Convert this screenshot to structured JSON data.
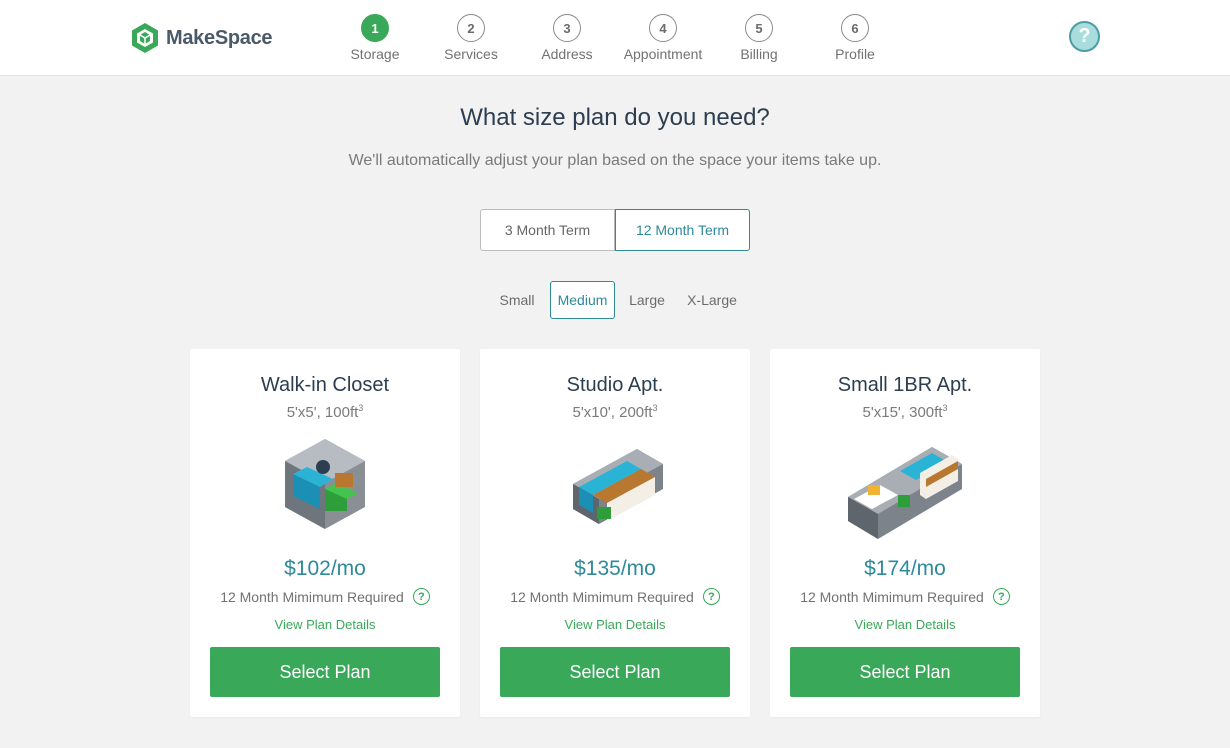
{
  "brand": {
    "name": "MakeSpace",
    "color": "#3aa859"
  },
  "steps": [
    {
      "num": "1",
      "label": "Storage"
    },
    {
      "num": "2",
      "label": "Services"
    },
    {
      "num": "3",
      "label": "Address"
    },
    {
      "num": "4",
      "label": "Appointment"
    },
    {
      "num": "5",
      "label": "Billing"
    },
    {
      "num": "6",
      "label": "Profile"
    }
  ],
  "active_step": "1",
  "help_icon": "question-icon",
  "heading": {
    "title": "What size plan do you need?",
    "subtitle": "We'll automatically adjust your plan based on the space your items take up."
  },
  "term": {
    "options": [
      "3 Month Term",
      "12 Month Term"
    ],
    "selected": "12 Month Term"
  },
  "sizes": {
    "options": [
      "Small",
      "Medium",
      "Large",
      "X-Large"
    ],
    "selected": "Medium"
  },
  "plans": [
    {
      "title": "Walk-in Closet",
      "dims": "5'x5', 100ft",
      "dims_sup": "3",
      "price": "$102/mo",
      "min": "12 Month Mimimum Required",
      "details": "View Plan Details",
      "button": "Select Plan"
    },
    {
      "title": "Studio Apt.",
      "dims": "5'x10', 200ft",
      "dims_sup": "3",
      "price": "$135/mo",
      "min": "12 Month Mimimum Required",
      "details": "View Plan Details",
      "button": "Select Plan"
    },
    {
      "title": "Small 1BR Apt.",
      "dims": "5'x15', 300ft",
      "dims_sup": "3",
      "price": "$174/mo",
      "min": "12 Month Mimimum Required",
      "details": "View Plan Details",
      "button": "Select Plan"
    }
  ],
  "colors": {
    "accent": "#2d8a99",
    "green": "#3aa859",
    "text": "#2d3e50"
  }
}
